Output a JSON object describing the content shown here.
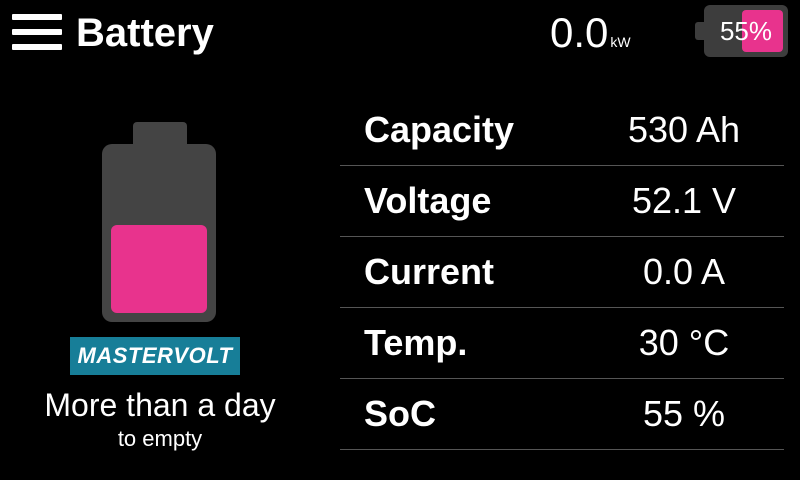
{
  "header": {
    "title": "Battery",
    "menu_icon": "hamburger-menu-icon",
    "power_value": "0.0",
    "power_unit": "kW",
    "battery_badge": {
      "percent_label": "55%",
      "level": 0.55
    }
  },
  "battery_graphic": {
    "level": 0.55,
    "fill_color": "#e8338d",
    "body_color": "#444444"
  },
  "brand": {
    "logo_text": "MASTERVOLT",
    "color": "#177e98"
  },
  "runtime": {
    "main": "More than a day",
    "sub": "to empty"
  },
  "info": [
    {
      "label": "Capacity",
      "value": "530 Ah"
    },
    {
      "label": "Voltage",
      "value": "52.1 V"
    },
    {
      "label": "Current",
      "value": "0.0 A"
    },
    {
      "label": "Temp.",
      "value": "30 °C"
    },
    {
      "label": "SoC",
      "value": "55 %"
    }
  ]
}
